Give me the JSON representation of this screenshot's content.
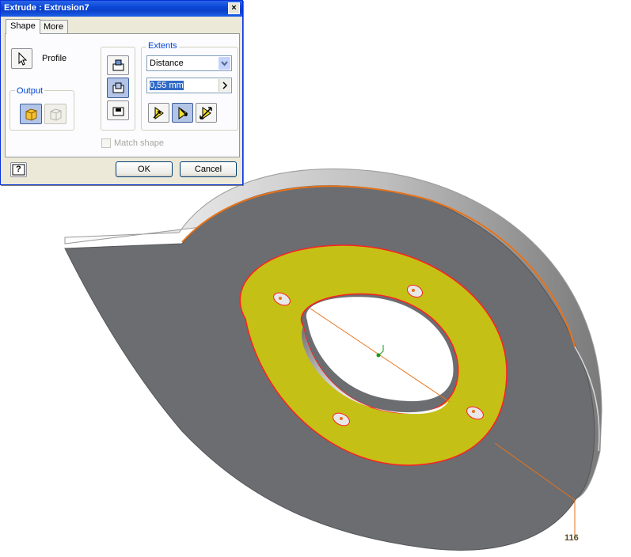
{
  "dialog": {
    "title": "Extrude : Extrusion7",
    "close_label": "×",
    "tabs": [
      {
        "label": "Shape"
      },
      {
        "label": "More"
      }
    ],
    "profile_label": "Profile",
    "output_label": "Output",
    "extents_label": "Extents",
    "extents_option": "Distance",
    "distance_value": "0,55 mm",
    "match_shape_label": "Match shape",
    "help_label": "?",
    "ok_label": "OK",
    "cancel_label": "Cancel"
  },
  "viewport": {
    "dimension_value": "116",
    "colors": {
      "body": "#6b6d71",
      "highlight_face": "#c5c016",
      "edge": "#e8731a",
      "profile_edge": "#ff2020"
    }
  }
}
